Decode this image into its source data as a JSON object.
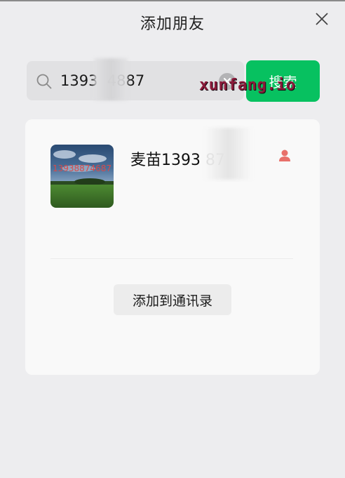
{
  "dialog": {
    "title": "添加朋友"
  },
  "search": {
    "value": "13938874887",
    "display_value": "1393  4887",
    "button_label": "搜索"
  },
  "watermark": "xunfang.io",
  "contact": {
    "name": "麦苗1393      87",
    "avatar_text": "13938874687",
    "gender": "female"
  },
  "actions": {
    "add_label": "添加到通讯录"
  },
  "colors": {
    "accent": "#07c160",
    "background": "#ededef",
    "card": "#f9f9f9"
  },
  "icons": [
    "close-icon",
    "search-icon",
    "clear-icon",
    "female-icon"
  ]
}
